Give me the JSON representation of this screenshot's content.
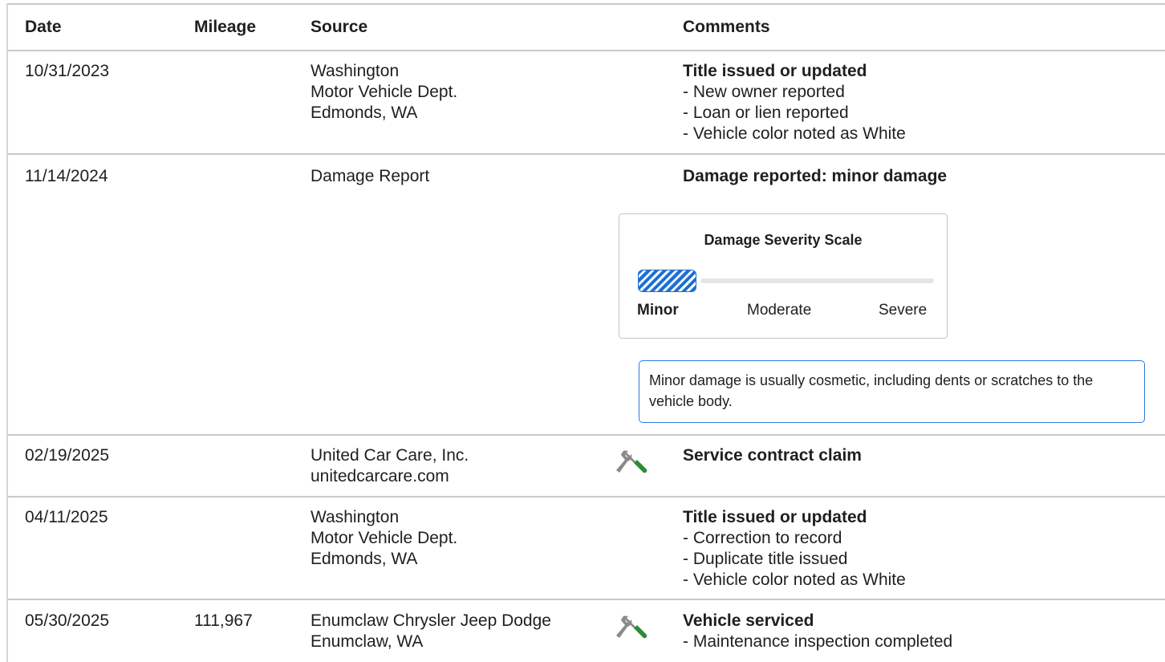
{
  "columns": {
    "date": "Date",
    "mileage": "Mileage",
    "source": "Source",
    "comments": "Comments"
  },
  "records": [
    {
      "date": "10/31/2023",
      "mileage": "",
      "source": [
        "Washington",
        "Motor Vehicle Dept.",
        "Edmonds, WA"
      ],
      "icon": "",
      "comment_title": "Title issued or updated",
      "details": [
        "New owner reported",
        "Loan or lien reported",
        "Vehicle color noted as White"
      ]
    },
    {
      "date": "11/14/2024",
      "mileage": "",
      "source": [
        "Damage Report"
      ],
      "icon": "",
      "comment_title": "Damage reported: minor damage",
      "details": [],
      "severity_scale": {
        "title": "Damage Severity Scale",
        "levels": [
          "Minor",
          "Moderate",
          "Severe"
        ],
        "selected": "Minor",
        "fill_fraction": 0.2
      },
      "note": "Minor damage is usually cosmetic, including dents or scratches to the vehicle body."
    },
    {
      "date": "02/19/2025",
      "mileage": "",
      "source": [
        "United Car Care, Inc.",
        "unitedcarcare.com"
      ],
      "icon": "wrench-screwdriver-icon",
      "comment_title": "Service contract claim",
      "details": []
    },
    {
      "date": "04/11/2025",
      "mileage": "",
      "source": [
        "Washington",
        "Motor Vehicle Dept.",
        "Edmonds, WA"
      ],
      "icon": "",
      "comment_title": "Title issued or updated",
      "details": [
        "Correction to record",
        "Duplicate title issued",
        "Vehicle color noted as White"
      ]
    },
    {
      "date": "05/30/2025",
      "mileage": "111,967",
      "source": [
        "Enumclaw Chrysler Jeep Dodge",
        "Enumclaw, WA"
      ],
      "icon": "wrench-screwdriver-icon",
      "comment_title": "Vehicle serviced",
      "details": [
        "Maintenance inspection completed"
      ]
    }
  ],
  "colors": {
    "accent": "#1d6fd0",
    "screwdriver_handle": "#2e8b3a",
    "tool_gray": "#8a8a8a",
    "border": "#c9c9c9"
  }
}
